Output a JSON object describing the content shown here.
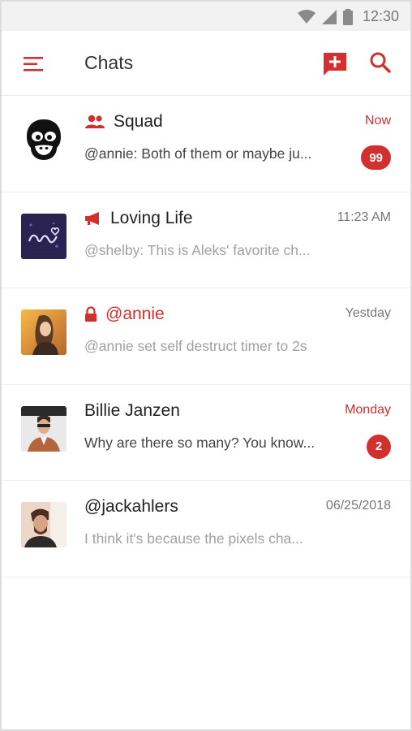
{
  "status_bar": {
    "time": "12:30"
  },
  "app_bar": {
    "title": "Chats"
  },
  "colors": {
    "accent": "#d32f2f",
    "muted_text": "#a0a0a0"
  },
  "chats": [
    {
      "name": "Squad",
      "type_icon": "group-icon",
      "avatar": "gorilla-logo",
      "time": "Now",
      "time_accent": true,
      "preview": "@annie: Both of them or maybe ju...",
      "preview_muted": false,
      "unread": "99"
    },
    {
      "name": "Loving Life",
      "type_icon": "megaphone-icon",
      "avatar": "love-image",
      "time": "11:23 AM",
      "time_accent": false,
      "preview": "@shelby: This is Aleks' favorite ch...",
      "preview_muted": true,
      "unread": ""
    },
    {
      "name": "@annie",
      "type_icon": "lock-icon",
      "avatar": "annie-photo",
      "time": "Yestday",
      "time_accent": false,
      "preview": "@annie set self destruct timer to 2s",
      "preview_muted": true,
      "unread": ""
    },
    {
      "name": "Billie Janzen",
      "type_icon": "",
      "avatar": "billie-photo",
      "time": "Monday",
      "time_accent": true,
      "preview": "Why are there so many? You know...",
      "preview_muted": false,
      "unread": "2"
    },
    {
      "name": "@jackahlers",
      "type_icon": "",
      "avatar": "jack-photo",
      "time": "06/25/2018",
      "time_accent": false,
      "preview": "I think it's because the pixels cha...",
      "preview_muted": true,
      "unread": ""
    }
  ]
}
